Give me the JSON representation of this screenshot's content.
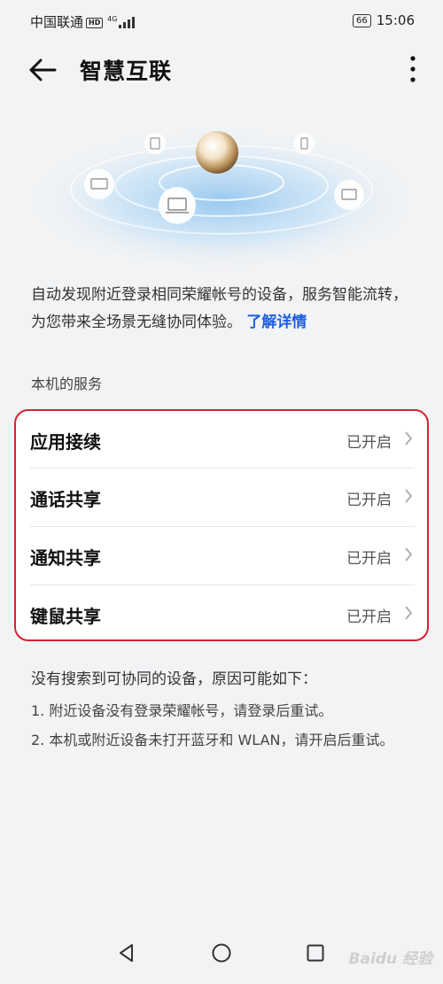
{
  "status_bar": {
    "carrier": "中国联通",
    "network_badge": "HD",
    "signal_badge": "4G",
    "battery": "66",
    "time": "15:06"
  },
  "header": {
    "title": "智慧互联",
    "back_icon": "arrow-left-icon",
    "more_icon": "more-vertical-icon"
  },
  "intro": {
    "description": "自动发现附近登录相同荣耀帐号的设备，服务智能流转，为您带来全场景无缝协同体验。",
    "learn_more": "了解详情"
  },
  "services": {
    "section_title": "本机的服务",
    "items": [
      {
        "label": "应用接续",
        "status": "已开启"
      },
      {
        "label": "通话共享",
        "status": "已开启"
      },
      {
        "label": "通知共享",
        "status": "已开启"
      },
      {
        "label": "键鼠共享",
        "status": "已开启"
      }
    ],
    "highlight_color": "#d42231"
  },
  "notes": {
    "title": "没有搜索到可协同的设备，原因可能如下：",
    "items": [
      "1. 附近设备没有登录荣耀帐号，请登录后重试。",
      "2. 本机或附近设备未打开蓝牙和 WLAN，请开启后重试。"
    ]
  },
  "nav_bar": {
    "back_icon": "triangle-back-icon",
    "home_icon": "circle-home-icon",
    "recent_icon": "square-recent-icon"
  },
  "watermark": "Baidu 经验",
  "colors": {
    "accent": "#1e5edb",
    "background": "#f1f3f5"
  }
}
